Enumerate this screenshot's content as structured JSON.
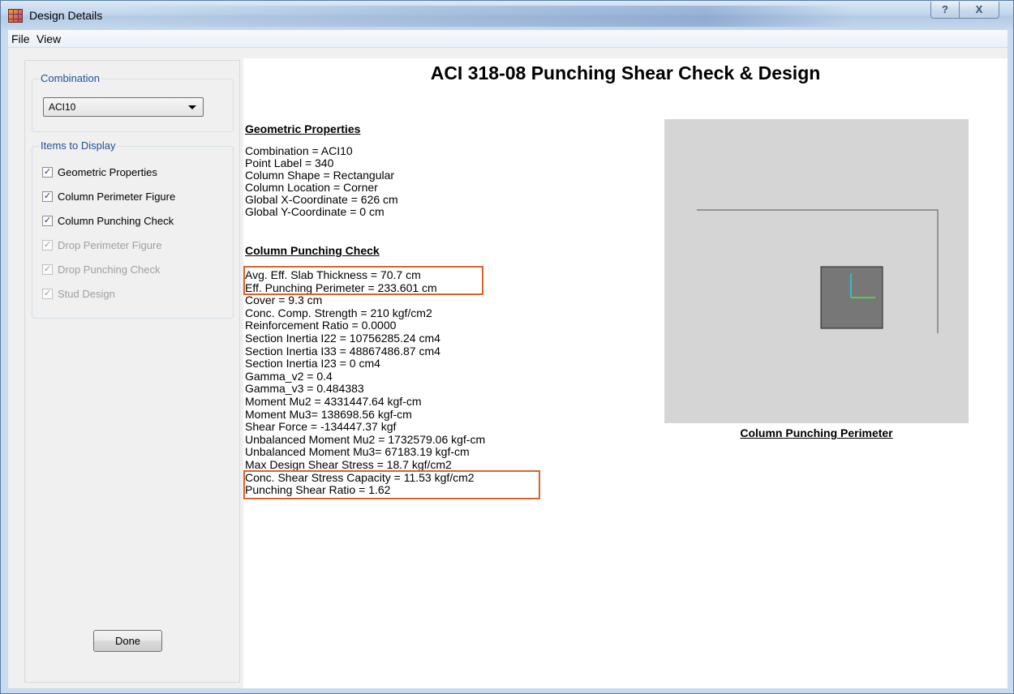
{
  "window": {
    "title": "Design Details",
    "help_label": "?",
    "close_label": "X"
  },
  "menu": {
    "items": [
      "File",
      "View"
    ]
  },
  "left_panel": {
    "combination_group_label": "Combination",
    "combination_value": "ACI10",
    "items_group_label": "Items to Display",
    "items": [
      {
        "label": "Geometric Properties",
        "checked": true,
        "enabled": true
      },
      {
        "label": "Column Perimeter Figure",
        "checked": true,
        "enabled": true
      },
      {
        "label": "Column Punching Check",
        "checked": true,
        "enabled": true
      },
      {
        "label": "Drop Perimeter Figure",
        "checked": true,
        "enabled": false
      },
      {
        "label": "Drop Punching Check",
        "checked": true,
        "enabled": false
      },
      {
        "label": "Stud Design",
        "checked": true,
        "enabled": false
      }
    ],
    "done_label": "Done"
  },
  "report": {
    "title": "ACI 318-08 Punching Shear Check & Design",
    "geometric_heading": "Geometric Properties",
    "geometric_lines": [
      "Combination = ACI10",
      "Point Label = 340",
      "Column Shape = Rectangular",
      "Column Location = Corner",
      "Global X-Coordinate = 626 cm",
      "Global Y-Coordinate = 0 cm"
    ],
    "punching_heading": "Column Punching Check",
    "punching_lines": [
      "Avg. Eff. Slab Thickness = 70.7 cm",
      "Eff. Punching Perimeter = 233.601 cm",
      "Cover = 9.3 cm",
      "Conc. Comp. Strength = 210 kgf/cm2",
      "Reinforcement Ratio = 0.0000",
      "Section Inertia I22 = 10756285.24 cm4",
      "Section Inertia I33 = 48867486.87 cm4",
      "Section Inertia I23 = 0 cm4",
      "Gamma_v2 = 0.4",
      "Gamma_v3 = 0.484383",
      "Moment Mu2 = 4331447.64 kgf-cm",
      "Moment Mu3= 138698.56 kgf-cm",
      "Shear Force = -134447.37 kgf",
      "Unbalanced Moment Mu2 = 1732579.06 kgf-cm",
      "Unbalanced Moment Mu3= 67183.19 kgf-cm",
      "Max Design Shear Stress = 18.7 kgf/cm2",
      "Conc. Shear Stress Capacity = 11.53 kgf/cm2",
      "Punching Shear Ratio = 1.62"
    ],
    "figure_caption": "Column Punching Perimeter"
  }
}
